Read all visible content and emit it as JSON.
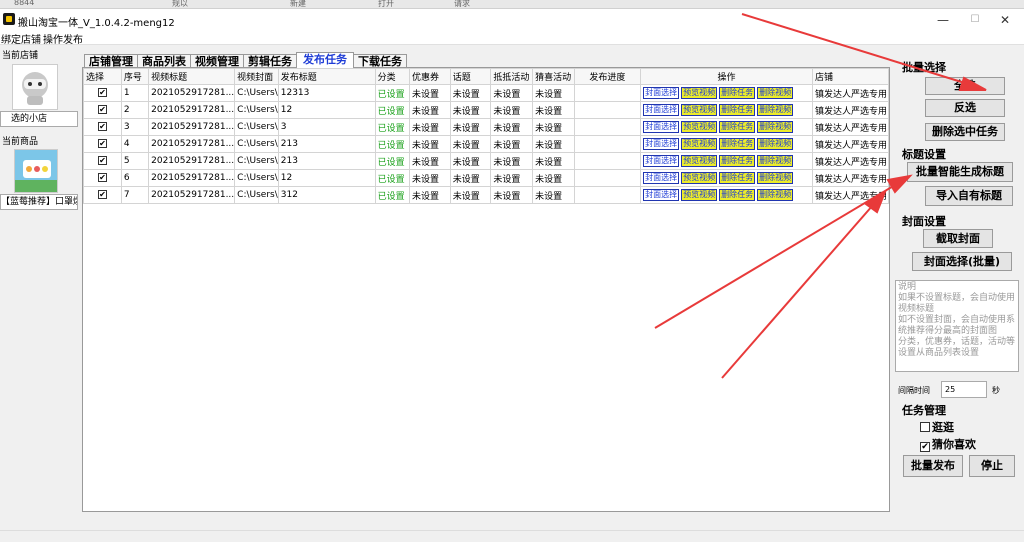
{
  "title_strip": {
    "items": [
      "8844",
      "规以",
      "新建",
      "打开",
      "请求"
    ]
  },
  "window": {
    "title": "搬山淘宝一体_V_1.0.4.2-meng12",
    "minimize": "—",
    "maximize": "☐",
    "close": "✕"
  },
  "menu": {
    "items": [
      "绑定店铺",
      "操作发布"
    ]
  },
  "left": {
    "current_store_label": "当前店铺",
    "store_name": "选的小店",
    "current_product_label": "当前商品",
    "product_name": "【蓝莓推荐】口罩爆琲"
  },
  "tabs": [
    "店铺管理",
    "商品列表",
    "视频管理",
    "剪辑任务",
    "发布任务",
    "下载任务"
  ],
  "active_tab": 4,
  "table": {
    "headers": [
      "选择",
      "序号",
      "视频标题",
      "视频封面",
      "发布标题",
      "分类",
      "优惠券",
      "话题",
      "抵抵活动",
      "猜喜活动",
      "发布进度",
      "操作",
      "店铺"
    ],
    "ops": [
      "封面选择",
      "预览视频",
      "删除任务",
      "删除视频"
    ],
    "rows": [
      {
        "checked": "✔",
        "no": "1",
        "video_title": "2021052917281...",
        "cover": "C:\\Users\\",
        "publish_title": "12313",
        "category": "已设置",
        "coupon": "未设置",
        "topic": "未设置",
        "activity1": "未设置",
        "activity2": "未设置",
        "progress": "",
        "store": "镇发达人严选专用"
      },
      {
        "checked": "✔",
        "no": "2",
        "video_title": "2021052917281...",
        "cover": "C:\\Users\\",
        "publish_title": "12",
        "category": "已设置",
        "coupon": "未设置",
        "topic": "未设置",
        "activity1": "未设置",
        "activity2": "未设置",
        "progress": "",
        "store": "镇发达人严选专用"
      },
      {
        "checked": "✔",
        "no": "3",
        "video_title": "2021052917281...",
        "cover": "C:\\Users\\",
        "publish_title": "3",
        "category": "已设置",
        "coupon": "未设置",
        "topic": "未设置",
        "activity1": "未设置",
        "activity2": "未设置",
        "progress": "",
        "store": "镇发达人严选专用"
      },
      {
        "checked": "✔",
        "no": "4",
        "video_title": "2021052917281...",
        "cover": "C:\\Users\\",
        "publish_title": "213",
        "category": "已设置",
        "coupon": "未设置",
        "topic": "未设置",
        "activity1": "未设置",
        "activity2": "未设置",
        "progress": "",
        "store": "镇发达人严选专用"
      },
      {
        "checked": "✔",
        "no": "5",
        "video_title": "2021052917281...",
        "cover": "C:\\Users\\",
        "publish_title": "213",
        "category": "已设置",
        "coupon": "未设置",
        "topic": "未设置",
        "activity1": "未设置",
        "activity2": "未设置",
        "progress": "",
        "store": "镇发达人严选专用"
      },
      {
        "checked": "✔",
        "no": "6",
        "video_title": "2021052917281...",
        "cover": "C:\\Users\\",
        "publish_title": "12",
        "category": "已设置",
        "coupon": "未设置",
        "topic": "未设置",
        "activity1": "未设置",
        "activity2": "未设置",
        "progress": "",
        "store": "镇发达人严选专用"
      },
      {
        "checked": "✔",
        "no": "7",
        "video_title": "2021052917281...",
        "cover": "C:\\Users\\",
        "publish_title": "312",
        "category": "已设置",
        "coupon": "未设置",
        "topic": "未设置",
        "activity1": "未设置",
        "activity2": "未设置",
        "progress": "",
        "store": "镇发达人严选专用"
      }
    ]
  },
  "right": {
    "batch_select_label": "批量选择",
    "select_all": "全选",
    "invert": "反选",
    "delete_selected": "删除选中任务",
    "title_settings_label": "标题设置",
    "batch_generate_title": "批量智能生成标题",
    "import_titles": "导入自有标题",
    "cover_settings_label": "封面设置",
    "capture_cover": "截取封面",
    "cover_select_batch": "封面选择(批量)",
    "description": "说明\n如果不设置标题，会自动使用视频标题\n如不设置封面，会自动使用系统推荐得分最高的封面图\n分类，优惠券，话题，活动等设置从商品列表设置",
    "interval_label": "间隔时间",
    "interval_value": "25",
    "interval_unit": "秒",
    "task_mgmt_label": "任务管理",
    "opt1_label": "逛逛",
    "opt1_checked": "",
    "opt2_label": "猜你喜欢",
    "opt2_checked": "✔",
    "batch_publish": "批量发布",
    "stop": "停止"
  },
  "colors": {
    "annotation_arrow": "#e83a3a",
    "active_tab_text": "#1e3cd6",
    "set_green": "#19a019",
    "op_yellow": "#ecec2a"
  }
}
